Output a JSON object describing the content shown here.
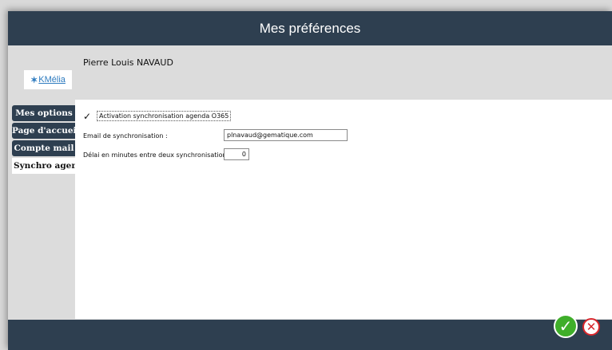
{
  "window": {
    "title": "Mes préférences"
  },
  "header": {
    "logo_text": "KMélia",
    "user_name": "Pierre Louis NAVAUD"
  },
  "tabs": [
    {
      "label": "Mes options",
      "active": false
    },
    {
      "label": "Page d'accueil",
      "active": false
    },
    {
      "label": "Compte mail",
      "active": false
    },
    {
      "label": "Synchro agenda",
      "active": true
    }
  ],
  "form": {
    "sync_checkbox": {
      "label": "Activation synchronisation agenda O365",
      "checked": true,
      "mark": "✓"
    },
    "email": {
      "label": "Email de synchronisation :",
      "value": "plnavaud@gematique.com"
    },
    "delay": {
      "label": "Délai en minutes entre deux synchronisation :",
      "value": "0"
    }
  },
  "footer": {
    "ok_icon": "checkmark-circle-icon",
    "ok_glyph": "✓",
    "cancel_icon": "close-circle-icon",
    "cancel_glyph": "✕"
  },
  "colors": {
    "titlebar": "#2e3f50",
    "ok": "#3fae2a",
    "cancel": "#d9262c"
  }
}
